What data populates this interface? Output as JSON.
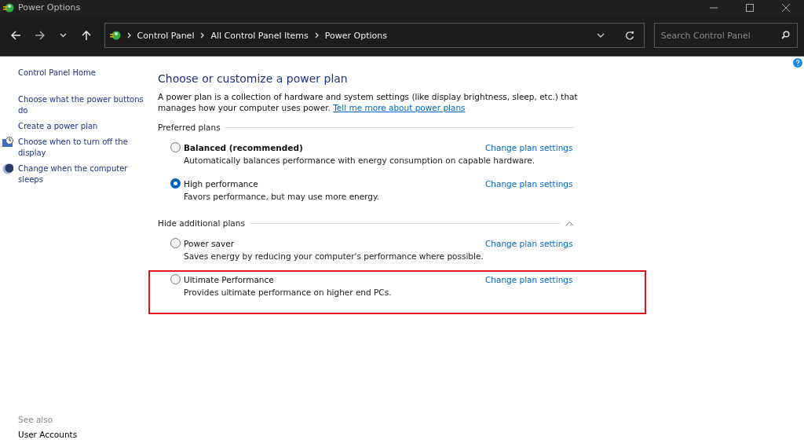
{
  "window": {
    "title": "Power Options"
  },
  "address_bar": {
    "breadcrumbs": [
      "Control Panel",
      "All Control Panel Items",
      "Power Options"
    ]
  },
  "search": {
    "placeholder": "Search Control Panel"
  },
  "sidebar": {
    "items": [
      {
        "label": "Control Panel Home",
        "kind": "link"
      },
      {
        "label": "Choose what the power buttons do",
        "kind": "link"
      },
      {
        "label": "Create a power plan",
        "kind": "link"
      },
      {
        "label": "Choose when to turn off the display",
        "kind": "display"
      },
      {
        "label": "Change when the computer sleeps",
        "kind": "sleep"
      }
    ],
    "see_also": {
      "heading": "See also",
      "links": [
        "User Accounts"
      ]
    }
  },
  "main": {
    "title": "Choose or customize a power plan",
    "intro": "A power plan is a collection of hardware and system settings (like display brightness, sleep, etc.) that manages how your computer uses power.",
    "intro_link": "Tell me more about power plans",
    "groups": [
      {
        "heading": "Preferred plans",
        "plans": [
          {
            "name": "Balanced (recommended)",
            "bold": true,
            "description": "Automatically balances performance with energy consumption on capable hardware.",
            "selected": false,
            "highlighted": false,
            "link": "Change plan settings"
          },
          {
            "name": "High performance",
            "bold": false,
            "description": "Favors performance, but may use more energy.",
            "selected": true,
            "highlighted": false,
            "link": "Change plan settings"
          }
        ]
      },
      {
        "heading": "Hide additional plans",
        "expanded": true,
        "plans": [
          {
            "name": "Power saver",
            "bold": false,
            "description": "Saves energy by reducing your computer's performance where possible.",
            "selected": false,
            "highlighted": false,
            "link": "Change plan settings"
          },
          {
            "name": "Ultimate Performance",
            "bold": false,
            "description": "Provides ultimate performance on higher end PCs.",
            "selected": false,
            "highlighted": true,
            "link": "Change plan settings"
          }
        ]
      }
    ]
  }
}
